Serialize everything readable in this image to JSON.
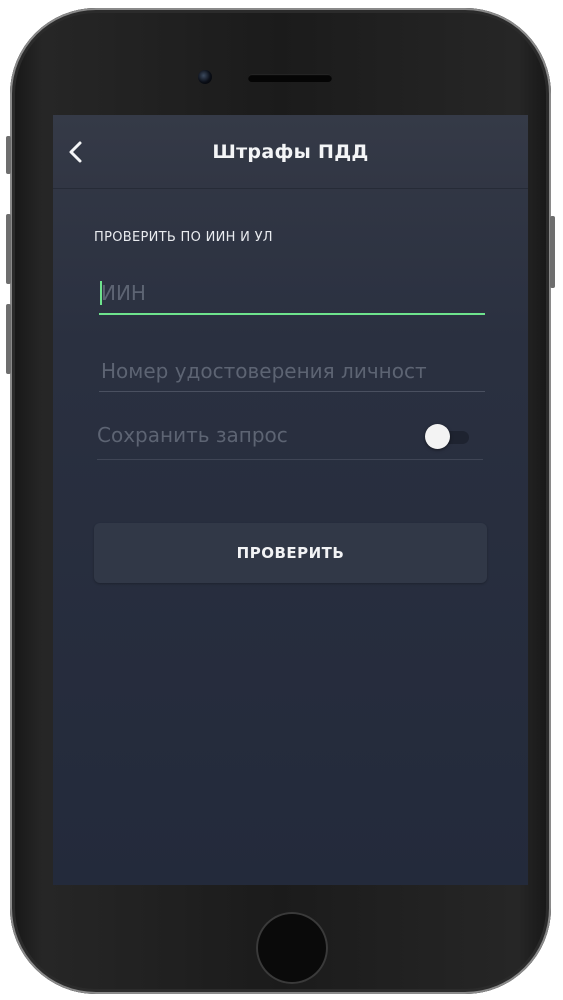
{
  "header": {
    "title": "Штрафы ПДД",
    "back_icon": "chevron-left-icon"
  },
  "form": {
    "section_label": "ПРОВЕРИТЬ ПО ИИН И УЛ",
    "iin": {
      "placeholder": "ИИН",
      "value": ""
    },
    "document": {
      "placeholder": "Номер удостоверения личност",
      "value": ""
    },
    "save_request": {
      "label": "Сохранить запрос",
      "enabled": false
    },
    "submit_label": "ПРОВЕРИТЬ"
  },
  "colors": {
    "accent": "#6ee38d",
    "screen_bg": "#232a3b",
    "navbar_bg": "#343946",
    "button_bg": "#313847"
  }
}
